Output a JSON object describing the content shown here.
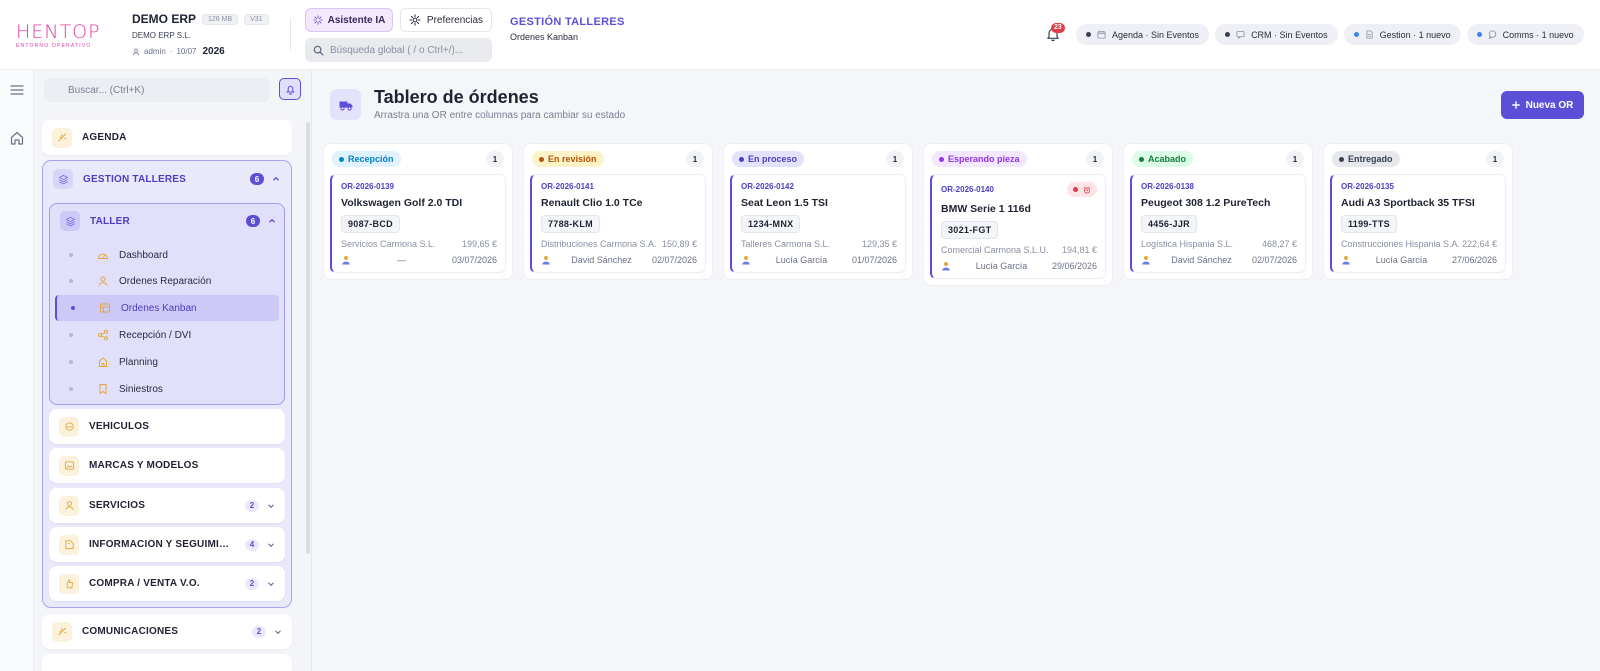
{
  "app": {
    "logo_text": "HENTOP",
    "logo_sub": "ENTORNO OPERATIVO",
    "company_name": "DEMO ERP",
    "company_legal": "DEMO ERP S.L.",
    "storage": "126 MB",
    "version": "V31",
    "user": "admin",
    "date": "10/07",
    "year": "2026"
  },
  "header": {
    "ai_button": "Asistente IA",
    "prefs_button": "Preferencias",
    "search_placeholder": "Búsqueda global ( / o Ctrl+/)...",
    "breadcrumb_title": "GESTIÓN TALLERES",
    "breadcrumb_sub": "Ordenes Kanban",
    "notif_count": "23",
    "status_pills": [
      {
        "label": "Agenda · Sin Eventos",
        "dot": "#3a3e52"
      },
      {
        "label": "CRM · Sin Eventos",
        "dot": "#3a3e52"
      },
      {
        "label": "Gestion · 1 nuevo",
        "dot": "#3b82f6"
      },
      {
        "label": "Comms · 1 nuevo",
        "dot": "#3b82f6"
      }
    ]
  },
  "sidebar": {
    "search_placeholder": "Buscar... (Ctrl+K)",
    "agenda": "AGENDA",
    "gestion": {
      "label": "GESTIÓN TALLERES",
      "count": "6"
    },
    "taller": {
      "label": "TALLER",
      "count": "6"
    },
    "taller_items": [
      {
        "label": "Dashboard"
      },
      {
        "label": "Ordenes Reparación"
      },
      {
        "label": "Ordenes Kanban"
      },
      {
        "label": "Recepción / DVI"
      },
      {
        "label": "Planning"
      },
      {
        "label": "Siniestros"
      }
    ],
    "sections": [
      {
        "label": "VEHÍCULOS",
        "count": ""
      },
      {
        "label": "MARCAS Y MODELOS",
        "count": ""
      },
      {
        "label": "SERVICIOS",
        "count": "2"
      },
      {
        "label": "INFORMACIÓN Y SEGUIMIENTO",
        "count": "4"
      },
      {
        "label": "COMPRA / VENTA V.O.",
        "count": "2"
      }
    ],
    "comunicaciones": {
      "label": "COMUNICACIONES",
      "count": "2"
    }
  },
  "main": {
    "title": "Tablero de órdenes",
    "subtitle": "Arrastra una OR entre columnas para cambiar su estado",
    "new_button": "Nueva OR",
    "columns": [
      {
        "stage": "Recepción",
        "count": "1",
        "bg": "#e0f2fe",
        "fg": "#0284c7",
        "card": {
          "code": "OR-2026-0139",
          "vehicle": "Volkswagen Golf 2.0 TDI",
          "plate": "9087-BCD",
          "client": "Servicios Carmona S.L.",
          "amount": "199,65 €",
          "tech": "—",
          "date": "03/07/2026",
          "alert": false
        }
      },
      {
        "stage": "En revisión",
        "count": "1",
        "bg": "#fef3c7",
        "fg": "#b45309",
        "card": {
          "code": "OR-2026-0141",
          "vehicle": "Renault Clio 1.0 TCe",
          "plate": "7788-KLM",
          "client": "Distribuciones Carmona S.A.",
          "amount": "150,89 €",
          "tech": "David Sánchez",
          "date": "02/07/2026",
          "alert": false
        }
      },
      {
        "stage": "En proceso",
        "count": "1",
        "bg": "#e4e2fb",
        "fg": "#4a3fc4",
        "card": {
          "code": "OR-2026-0142",
          "vehicle": "Seat Leon 1.5 TSI",
          "plate": "1234-MNX",
          "client": "Talleres Carmona S.L.",
          "amount": "129,35 €",
          "tech": "Lucía García",
          "date": "01/07/2026",
          "alert": false
        }
      },
      {
        "stage": "Esperando pieza",
        "count": "1",
        "bg": "#f3e8ff",
        "fg": "#9333ea",
        "card": {
          "code": "OR-2026-0140",
          "vehicle": "BMW Serie 1 116d",
          "plate": "3021-FGT",
          "client": "Comercial Carmona S.L.U.",
          "amount": "194,81 €",
          "tech": "Lucía García",
          "date": "29/06/2026",
          "alert": true
        }
      },
      {
        "stage": "Acabado",
        "count": "1",
        "bg": "#dcfce7",
        "fg": "#15803d",
        "card": {
          "code": "OR-2026-0138",
          "vehicle": "Peugeot 308 1.2 PureTech",
          "plate": "4456-JJR",
          "client": "Logística Hispania S.L.",
          "amount": "468,27 €",
          "tech": "David Sánchez",
          "date": "02/07/2026",
          "alert": false
        }
      },
      {
        "stage": "Entregado",
        "count": "1",
        "bg": "#e5e7eb",
        "fg": "#374151",
        "card": {
          "code": "OR-2026-0135",
          "vehicle": "Audi A3 Sportback 35 TFSI",
          "plate": "1199-TTS",
          "client": "Construcciones Hispania S.A.",
          "amount": "222,64 €",
          "tech": "Lucía García",
          "date": "27/06/2026",
          "alert": false
        }
      }
    ]
  },
  "colors": {
    "accent": "#5b4fd8",
    "logo": "#e33ca7",
    "danger": "#e53946"
  },
  "icons": [
    "menu-icon",
    "home-icon",
    "sparkle-icon",
    "gear-icon",
    "search-icon",
    "bell-icon",
    "calendar-icon",
    "pin-icon",
    "truck-icon",
    "plus-icon",
    "user-icon",
    "alarm-icon",
    "chevron-up-icon",
    "chevron-down-icon"
  ]
}
